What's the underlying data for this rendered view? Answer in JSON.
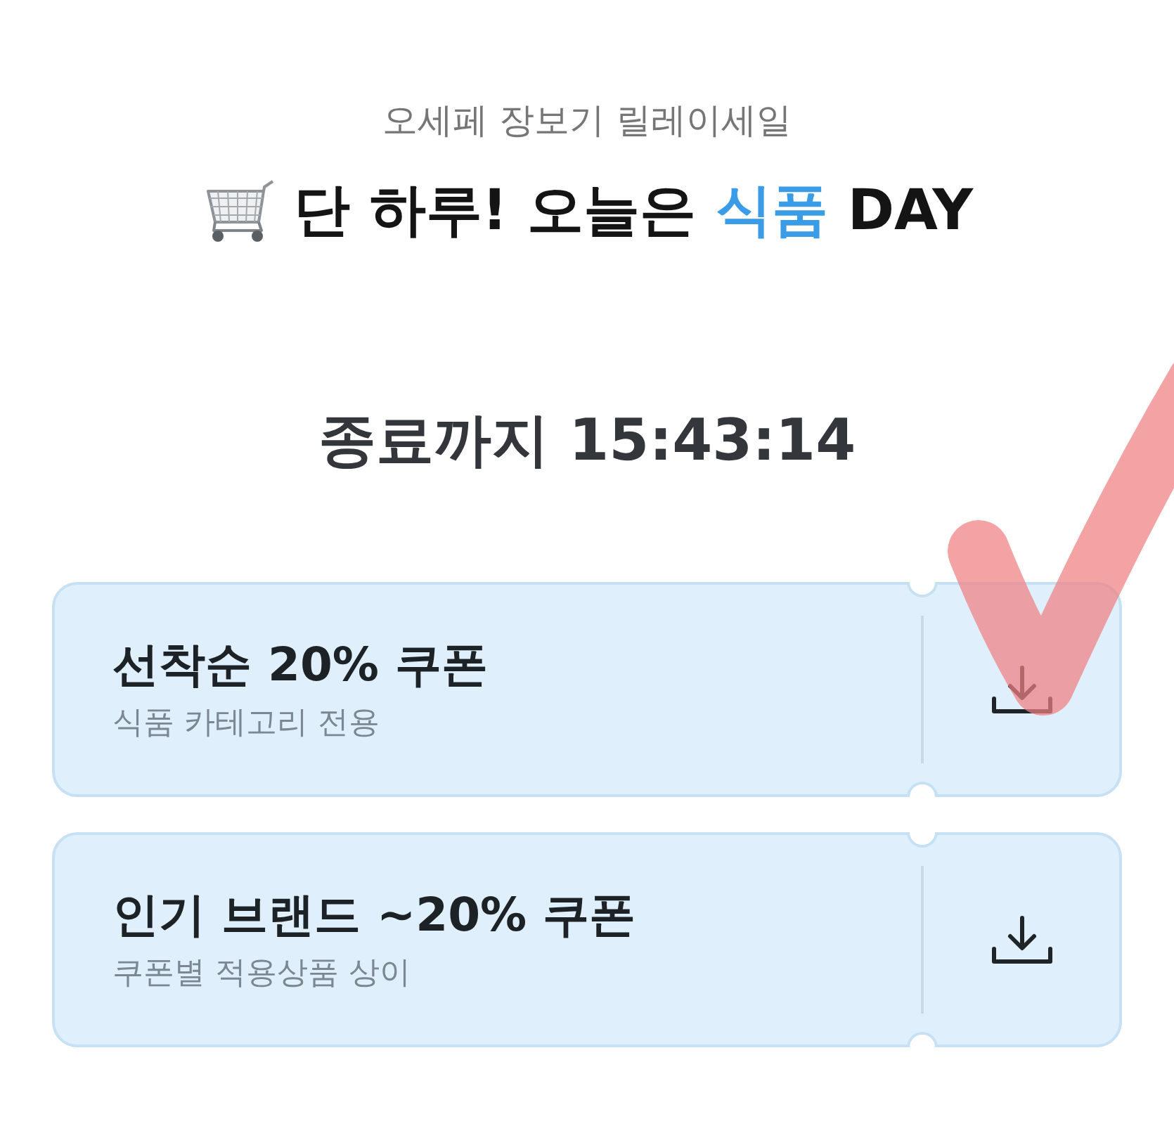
{
  "header": {
    "subtitle": "오세페 장보기 릴레이세일",
    "title": [
      {
        "text": "단 하루! 오늘은",
        "highlight": false
      },
      {
        "text": "식품",
        "highlight": true
      },
      {
        "text": "DAY",
        "highlight": false
      }
    ]
  },
  "countdown": {
    "text": "종료까지 15:43:14"
  },
  "coupons": [
    {
      "title": "선착순 20% 쿠폰",
      "note": "식품 카테고리 전용",
      "marked": true
    },
    {
      "title": "인기 브랜드 ~20% 쿠폰",
      "note": "쿠폰별 적용상품 상이",
      "marked": false
    }
  ]
}
